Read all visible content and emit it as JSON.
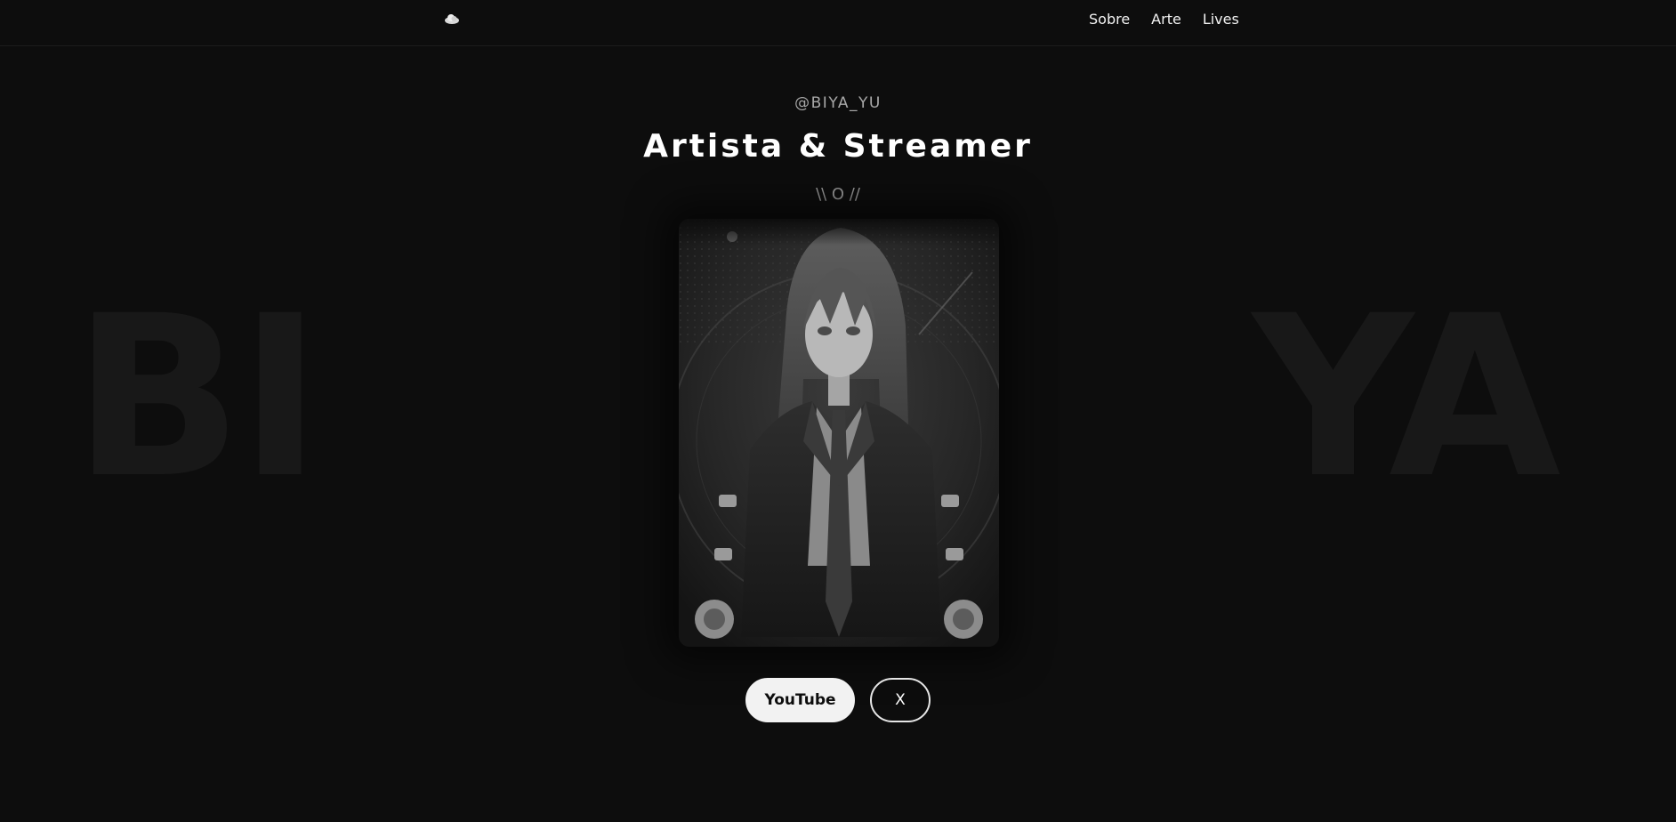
{
  "background": {
    "left_word": "BI",
    "right_word": "YA"
  },
  "header": {
    "logo": "cloud-logo-icon",
    "nav": [
      "Sobre",
      "Arte",
      "Lives"
    ]
  },
  "hero": {
    "handle": "@BIYA_YU",
    "headline": "Artista & Streamer",
    "subline": "\\\\ O //",
    "portrait": "grayscale-anime-character-portrait"
  },
  "buttons": {
    "youtube": "YouTube",
    "x": "X"
  },
  "colors": {
    "background": "#0d0d0d",
    "bg_word": "#181818",
    "text": "#ffffff",
    "muted": "#a8a8a8",
    "button_light": "#f2f2f2"
  }
}
